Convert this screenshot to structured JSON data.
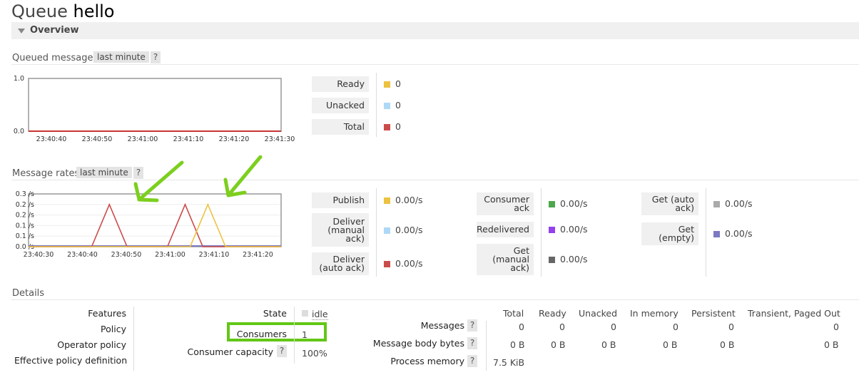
{
  "header": {
    "prefix": "Queue",
    "name": "hello"
  },
  "overview": {
    "label": "Overview"
  },
  "queued": {
    "title": "Queued messages",
    "range": "last minute",
    "help": "?",
    "chart": {
      "type": "line",
      "x_ticks": [
        "23:40:40",
        "23:40:50",
        "23:41:00",
        "23:41:10",
        "23:41:20",
        "23:41:30"
      ],
      "y_ticks": [
        "1.0",
        "0.0"
      ],
      "ylim": [
        0,
        1
      ],
      "series": [
        {
          "values": [
            0,
            0,
            0,
            0,
            0,
            0
          ],
          "color": "#cc3333"
        }
      ]
    },
    "legend": [
      {
        "label": "Ready",
        "value": "0",
        "color": "#edc240"
      },
      {
        "label": "Unacked",
        "value": "0",
        "color": "#afd8f8"
      },
      {
        "label": "Total",
        "value": "0",
        "color": "#cb4b4b"
      }
    ]
  },
  "rates": {
    "title": "Message rates",
    "range": "last minute",
    "help": "?",
    "chart": {
      "type": "line",
      "x_ticks": [
        "23:40:30",
        "23:40:40",
        "23:40:50",
        "23:41:00",
        "23:41:10",
        "23:41:20"
      ],
      "y_ticks": [
        "0.3 /s",
        "0.2 /s",
        "0.2 /s",
        "0.1 /s",
        "0.1 /s",
        "0.0 /s"
      ],
      "ylim": [
        0,
        0.25
      ],
      "series": [
        {
          "color": "#cb4b4b",
          "points": [
            [
              0,
              0
            ],
            [
              25,
              0
            ],
            [
              32,
              0.2
            ],
            [
              39,
              0
            ],
            [
              55,
              0
            ],
            [
              62,
              0.2
            ],
            [
              69,
              0
            ],
            [
              100,
              0
            ]
          ]
        },
        {
          "color": "#edc240",
          "points": [
            [
              0,
              0
            ],
            [
              64,
              0
            ],
            [
              71,
              0.2
            ],
            [
              78,
              0
            ],
            [
              100,
              0
            ]
          ]
        }
      ]
    },
    "col1": [
      {
        "label": "Publish",
        "value": "0.00/s",
        "color": "#edc240"
      },
      {
        "label": "Deliver (manual ack)",
        "value": "0.00/s",
        "color": "#afd8f8"
      },
      {
        "label": "Deliver (auto ack)",
        "value": "0.00/s",
        "color": "#cb4b4b"
      }
    ],
    "col2": [
      {
        "label": "Consumer ack",
        "value": "0.00/s",
        "color": "#4da74d"
      },
      {
        "label": "Redelivered",
        "value": "0.00/s",
        "color": "#9440ed"
      },
      {
        "label": "Get (manual ack)",
        "value": "0.00/s",
        "color": "#666666"
      }
    ],
    "col3": [
      {
        "label": "Get (auto ack)",
        "value": "0.00/s",
        "color": "#aaaaaa"
      },
      {
        "label": "Get (empty)",
        "value": "0.00/s",
        "color": "#7c79c3"
      }
    ]
  },
  "details": {
    "title": "Details",
    "features": "Features",
    "policy": "Policy",
    "operator_policy": "Operator policy",
    "effective_policy": "Effective policy definition",
    "state_label": "State",
    "state_value": "idle",
    "consumers_label": "Consumers",
    "consumers_value": "1",
    "capacity_label": "Consumer capacity",
    "capacity_value": "100%",
    "help": "?",
    "table": {
      "columns": [
        "Total",
        "Ready",
        "Unacked",
        "In memory",
        "Persistent",
        "Transient, Paged Out"
      ],
      "rows": [
        {
          "label": "Messages",
          "values": [
            "0",
            "0",
            "0",
            "0",
            "0",
            "0"
          ]
        },
        {
          "label": "Message body bytes",
          "values": [
            "0 B",
            "0 B",
            "0 B",
            "0 B",
            "0 B",
            "0 B"
          ]
        },
        {
          "label": "Process memory",
          "values": [
            "7.5 KiB"
          ]
        }
      ]
    }
  },
  "annotations": {
    "arrow_color": "#7ccf1e",
    "highlight_color": "#62c716"
  }
}
